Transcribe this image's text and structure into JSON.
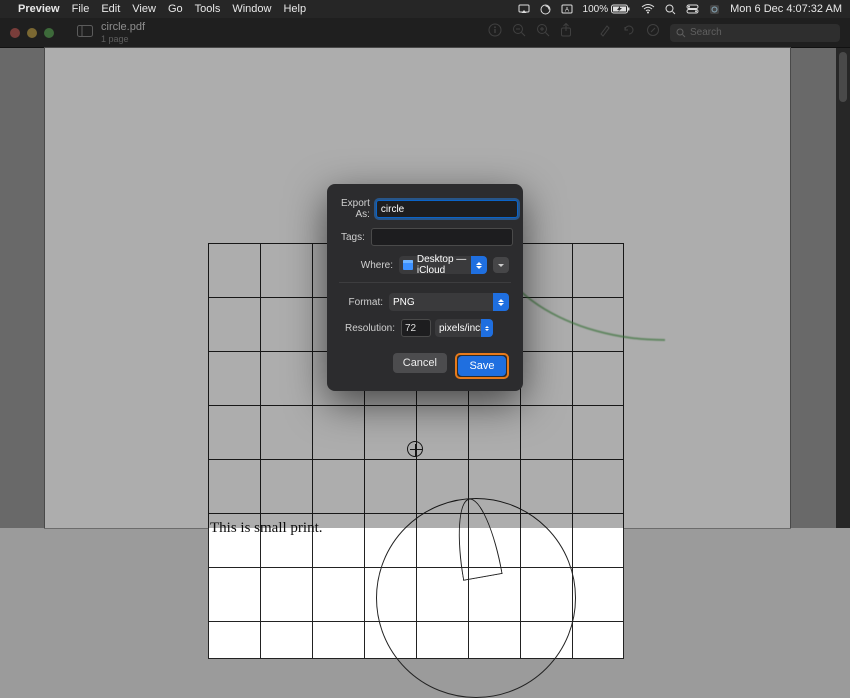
{
  "menubar": {
    "app_name": "Preview",
    "items": [
      "File",
      "Edit",
      "View",
      "Go",
      "Tools",
      "Window",
      "Help"
    ],
    "battery": "100%",
    "datetime": "Mon 6 Dec  4:07:32 AM"
  },
  "window": {
    "traffic_colors": {
      "close": "#ff5f57",
      "min": "#febc2e",
      "max": "#28c840"
    },
    "doc_title": "circle.pdf",
    "doc_subtitle": "1 page",
    "search_placeholder": "Search"
  },
  "document": {
    "small_print": "This is small print."
  },
  "export_sheet": {
    "labels": {
      "export_as": "Export As:",
      "tags": "Tags:",
      "where": "Where:",
      "format": "Format:",
      "resolution": "Resolution:"
    },
    "filename": "circle",
    "tags": "",
    "location": "Desktop — iCloud",
    "format": "PNG",
    "resolution_value": "72",
    "resolution_unit": "pixels/inch",
    "cancel_label": "Cancel",
    "save_label": "Save"
  }
}
